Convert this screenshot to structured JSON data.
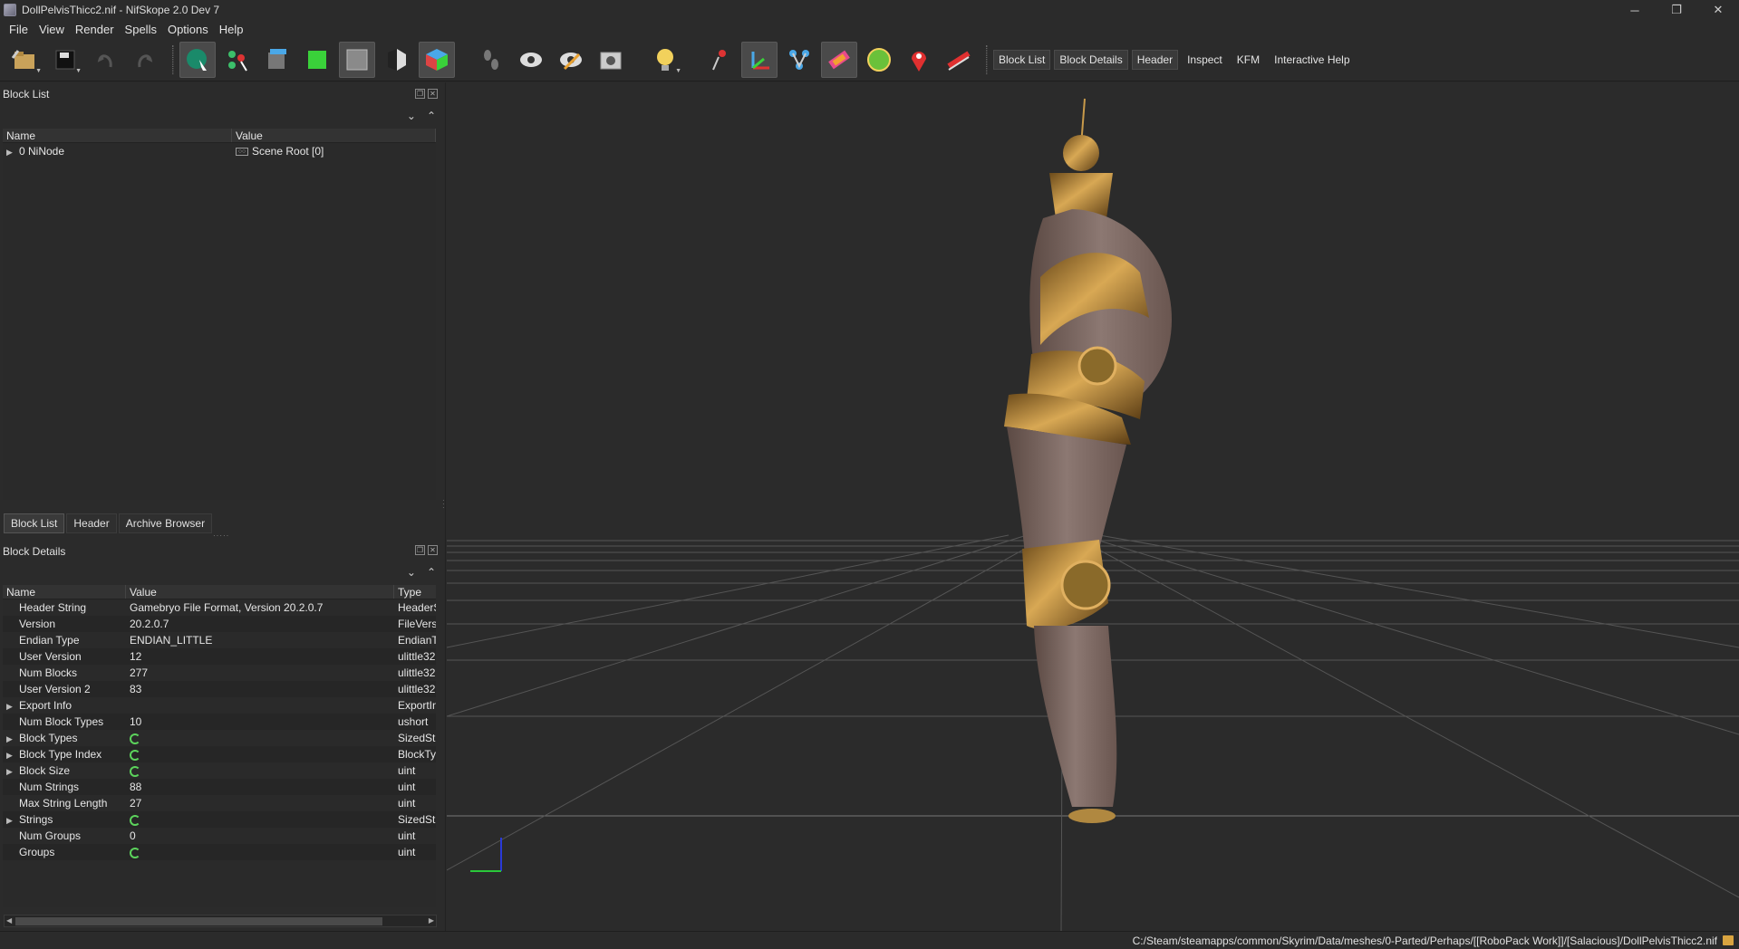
{
  "window": {
    "title": "DollPelvisThicc2.nif - NifSkope 2.0 Dev 7",
    "controls": {
      "minimize": "─",
      "maximize": "❐",
      "close": "✕"
    }
  },
  "menu": [
    "File",
    "View",
    "Render",
    "Spells",
    "Options",
    "Help"
  ],
  "toolbar": {
    "text_buttons": [
      "Block List",
      "Block Details",
      "Header",
      "Inspect",
      "KFM",
      "Interactive Help"
    ]
  },
  "block_list": {
    "title": "Block List",
    "columns": [
      "Name",
      "Value"
    ],
    "rows": [
      {
        "name": "0 NiNode",
        "value": "Scene Root [0]"
      }
    ]
  },
  "tabs": [
    "Block List",
    "Header",
    "Archive Browser"
  ],
  "block_details": {
    "title": "Block Details",
    "columns": [
      "Name",
      "Value",
      "Type"
    ],
    "rows": [
      {
        "name": "Header String",
        "value": "Gamebryo File Format, Version 20.2.0.7",
        "type": "HeaderS",
        "expand": false,
        "icon": false
      },
      {
        "name": "Version",
        "value": "20.2.0.7",
        "type": "FileVersi",
        "expand": false,
        "icon": false
      },
      {
        "name": "Endian Type",
        "value": "ENDIAN_LITTLE",
        "type": "EndianT",
        "expand": false,
        "icon": false
      },
      {
        "name": "User Version",
        "value": "12",
        "type": "ulittle32",
        "expand": false,
        "icon": false
      },
      {
        "name": "Num Blocks",
        "value": "277",
        "type": "ulittle32",
        "expand": false,
        "icon": false
      },
      {
        "name": "User Version 2",
        "value": "83",
        "type": "ulittle32",
        "expand": false,
        "icon": false
      },
      {
        "name": "Export Info",
        "value": "",
        "type": "ExportIn",
        "expand": true,
        "icon": false
      },
      {
        "name": "Num Block Types",
        "value": "10",
        "type": "ushort",
        "expand": false,
        "icon": false
      },
      {
        "name": "Block Types",
        "value": "",
        "type": "SizedStri",
        "expand": true,
        "icon": true
      },
      {
        "name": "Block Type Index",
        "value": "",
        "type": "BlockTy",
        "expand": true,
        "icon": true
      },
      {
        "name": "Block Size",
        "value": "",
        "type": "uint",
        "expand": true,
        "icon": true
      },
      {
        "name": "Num Strings",
        "value": "88",
        "type": "uint",
        "expand": false,
        "icon": false
      },
      {
        "name": "Max String Length",
        "value": "27",
        "type": "uint",
        "expand": false,
        "icon": false
      },
      {
        "name": "Strings",
        "value": "",
        "type": "SizedStri",
        "expand": true,
        "icon": true
      },
      {
        "name": "Num Groups",
        "value": "0",
        "type": "uint",
        "expand": false,
        "icon": false
      },
      {
        "name": "Groups",
        "value": "",
        "type": "uint",
        "expand": false,
        "icon": true
      }
    ]
  },
  "status": {
    "path": "C:/Steam/steamapps/common/Skyrim/Data/meshes/0-Parted/Perhaps/[[RoboPack Work]]/[Salacious]/DollPelvisThicc2.nif"
  }
}
